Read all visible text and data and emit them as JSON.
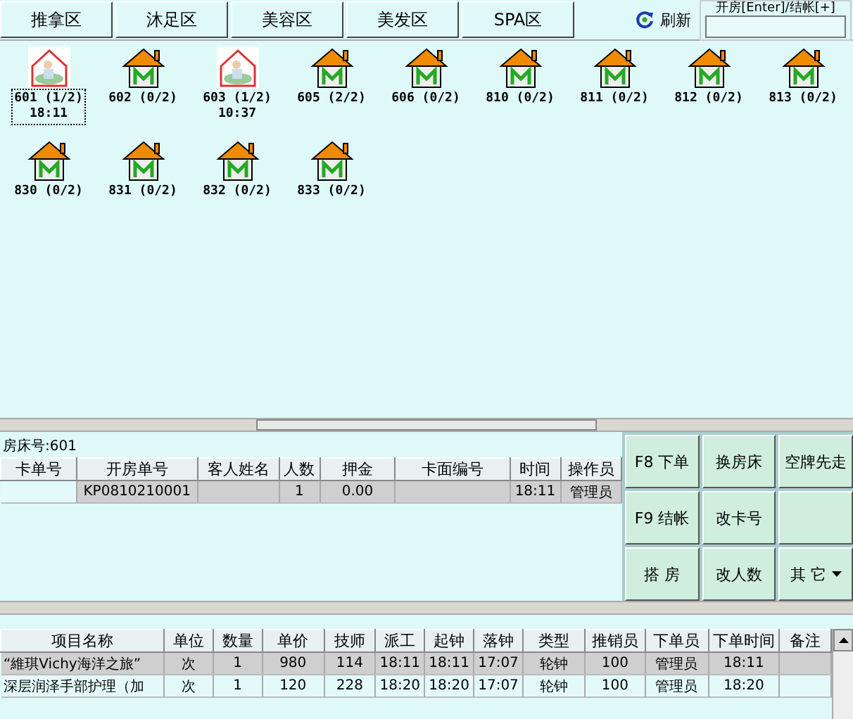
{
  "zone_tabs": [
    {
      "label": "推拿区",
      "selected": false
    },
    {
      "label": "沐足区",
      "selected": false
    },
    {
      "label": "美容区",
      "selected": false
    },
    {
      "label": "美发区",
      "selected": false
    },
    {
      "label": "SPA区",
      "selected": false
    }
  ],
  "refresh_button": {
    "label": "刷新"
  },
  "quick_open": {
    "label": "开房[Enter]/结帐[+]"
  },
  "rooms": [
    {
      "label": "601 (1/2)",
      "time": "18:11",
      "kind": "occupied",
      "selected": true
    },
    {
      "label": "602 (0/2)",
      "kind": "vacant",
      "selected": false
    },
    {
      "label": "603 (1/2)",
      "time": "10:37",
      "kind": "occupied",
      "selected": false
    },
    {
      "label": "605 (2/2)",
      "kind": "vacant",
      "selected": false
    },
    {
      "label": "606 (0/2)",
      "kind": "vacant",
      "selected": false
    },
    {
      "label": "810 (0/2)",
      "kind": "vacant",
      "selected": false
    },
    {
      "label": "811 (0/2)",
      "kind": "vacant",
      "selected": false
    },
    {
      "label": "812 (0/2)",
      "kind": "vacant",
      "selected": false
    },
    {
      "label": "813 (0/2)",
      "kind": "vacant",
      "selected": false
    },
    {
      "label": "830 (0/2)",
      "kind": "vacant",
      "selected": false
    },
    {
      "label": "831 (0/2)",
      "kind": "vacant",
      "selected": false
    },
    {
      "label": "832 (0/2)",
      "kind": "vacant",
      "selected": false
    },
    {
      "label": "833 (0/2)",
      "kind": "vacant",
      "selected": false
    }
  ],
  "room_panel": {
    "title": "房床号:601",
    "columns": [
      "卡单号",
      "开房单号",
      "客人姓名",
      "人数",
      "押金",
      "卡面编号",
      "时间",
      "操作员"
    ],
    "rows": [
      {
        "cells": [
          "",
          "KP0810210001",
          "",
          "1",
          "0.00",
          "",
          "18:11",
          "管理员"
        ],
        "selected": true
      }
    ]
  },
  "actions": [
    {
      "label": "F8 下单",
      "kind": "plain"
    },
    {
      "label": "换房床",
      "kind": "plain"
    },
    {
      "label": "空牌先走",
      "kind": "plain"
    },
    {
      "label": "F9 结帐",
      "kind": "plain"
    },
    {
      "label": "改卡号",
      "kind": "plain"
    },
    {
      "kind": "blank"
    },
    {
      "label": "搭 房",
      "kind": "plain"
    },
    {
      "label": "改人数",
      "kind": "plain"
    },
    {
      "label": "其 它",
      "kind": "dropdown"
    }
  ],
  "items_table": {
    "columns": [
      "项目名称",
      "单位",
      "数量",
      "单价",
      "技师",
      "派工",
      "起钟",
      "落钟",
      "类型",
      "推销员",
      "下单员",
      "下单时间",
      "备注"
    ],
    "rows": [
      {
        "cells": [
          "“維琪Vichy海洋之旅”",
          "次",
          "1",
          "980",
          "114",
          "18:11",
          "18:11",
          "17:07",
          "轮钟",
          "100",
          "管理员",
          "18:11",
          ""
        ],
        "selected": true
      },
      {
        "cells": [
          "深层润泽手部护理（加",
          "次",
          "1",
          "120",
          "228",
          "18:20",
          "18:20",
          "17:07",
          "轮钟",
          "100",
          "管理员",
          "18:20",
          ""
        ],
        "selected": false
      }
    ]
  }
}
